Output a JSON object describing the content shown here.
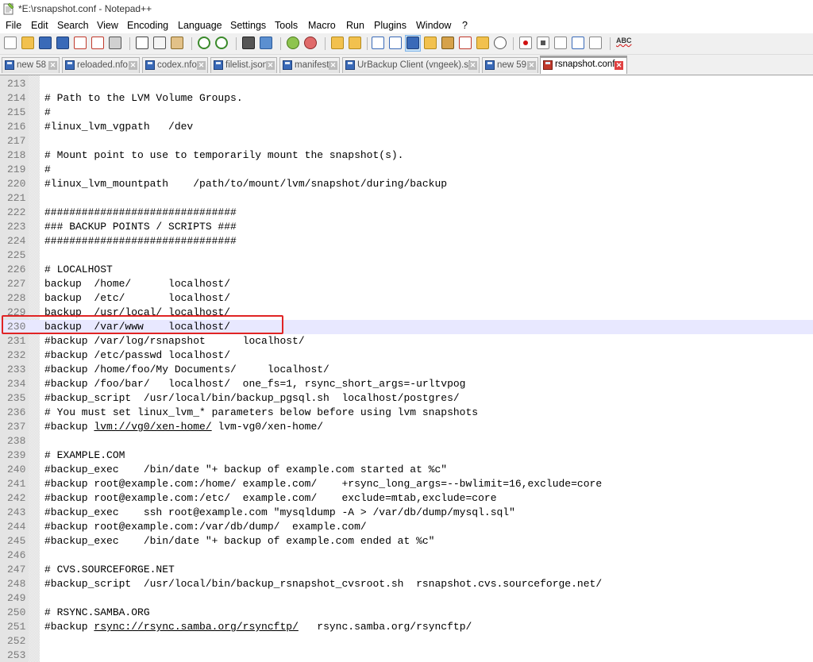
{
  "window": {
    "title": "*E:\\rsnapshot.conf - Notepad++"
  },
  "menu": [
    "File",
    "Edit",
    "Search",
    "View",
    "Encoding",
    "Language",
    "Settings",
    "Tools",
    "Macro",
    "Run",
    "Plugins",
    "Window",
    "?"
  ],
  "toolbar": {
    "icons": [
      "new-file-icon",
      "open-file-icon",
      "save-icon",
      "save-all-icon",
      "close-icon",
      "close-all-icon",
      "print-icon",
      "cut-icon",
      "copy-icon",
      "paste-icon",
      "undo-icon",
      "redo-icon",
      "find-icon",
      "replace-icon",
      "zoom-in-icon",
      "zoom-out-icon",
      "sync-vertical-icon",
      "sync-horizontal-icon",
      "word-wrap-icon",
      "show-all-chars-icon",
      "indent-guide-icon",
      "language-icon",
      "doc-map-icon",
      "function-list-icon",
      "folder-workspace-icon",
      "monitoring-icon",
      "record-macro-icon",
      "stop-record-icon",
      "play-macro-icon",
      "run-macro-multiple-icon",
      "save-macro-icon",
      "spell-check-icon"
    ],
    "spell_check_label": "ABC"
  },
  "tabs": [
    {
      "label": "new 58",
      "saved": true,
      "active": false
    },
    {
      "label": "reloaded.nfo",
      "saved": true,
      "active": false
    },
    {
      "label": "codex.nfo",
      "saved": true,
      "active": false
    },
    {
      "label": "filelist.json",
      "saved": true,
      "active": false
    },
    {
      "label": "manifest",
      "saved": true,
      "active": false
    },
    {
      "label": "UrBackup Client (vngeek).sh",
      "saved": true,
      "active": false
    },
    {
      "label": "new 59",
      "saved": true,
      "active": false
    },
    {
      "label": "rsnapshot.conf",
      "saved": false,
      "active": true
    }
  ],
  "tab_close_glyph": "✕",
  "editor": {
    "current_line": 230,
    "lines": [
      {
        "n": "213",
        "text": ""
      },
      {
        "n": "214",
        "text": "# Path to the LVM Volume Groups."
      },
      {
        "n": "215",
        "text": "#"
      },
      {
        "n": "216",
        "text": "#linux_lvm_vgpath   /dev"
      },
      {
        "n": "217",
        "text": ""
      },
      {
        "n": "218",
        "text": "# Mount point to use to temporarily mount the snapshot(s)."
      },
      {
        "n": "219",
        "text": "#"
      },
      {
        "n": "220",
        "text": "#linux_lvm_mountpath    /path/to/mount/lvm/snapshot/during/backup"
      },
      {
        "n": "221",
        "text": ""
      },
      {
        "n": "222",
        "text": "###############################"
      },
      {
        "n": "223",
        "text": "### BACKUP POINTS / SCRIPTS ###"
      },
      {
        "n": "224",
        "text": "###############################"
      },
      {
        "n": "225",
        "text": ""
      },
      {
        "n": "226",
        "text": "# LOCALHOST"
      },
      {
        "n": "227",
        "text": "backup  /home/      localhost/"
      },
      {
        "n": "228",
        "text": "backup  /etc/       localhost/"
      },
      {
        "n": "229",
        "text": "backup  /usr/local/ localhost/"
      },
      {
        "n": "230",
        "text": "backup  /var/www    localhost/"
      },
      {
        "n": "231",
        "text": "#backup /var/log/rsnapshot      localhost/"
      },
      {
        "n": "232",
        "text": "#backup /etc/passwd localhost/"
      },
      {
        "n": "233",
        "text": "#backup /home/foo/My Documents/     localhost/"
      },
      {
        "n": "234",
        "text": "#backup /foo/bar/   localhost/  one_fs=1, rsync_short_args=-urltvpog"
      },
      {
        "n": "235",
        "text": "#backup_script  /usr/local/bin/backup_pgsql.sh  localhost/postgres/"
      },
      {
        "n": "236",
        "text": "# You must set linux_lvm_* parameters below before using lvm snapshots"
      },
      {
        "n": "237",
        "text": "#backup ",
        "url": "lvm://vg0/xen-home/",
        "after": " lvm-vg0/xen-home/"
      },
      {
        "n": "238",
        "text": ""
      },
      {
        "n": "239",
        "text": "# EXAMPLE.COM"
      },
      {
        "n": "240",
        "text": "#backup_exec    /bin/date \"+ backup of example.com started at %c\""
      },
      {
        "n": "241",
        "text": "#backup root@example.com:/home/ example.com/    +rsync_long_args=--bwlimit=16,exclude=core"
      },
      {
        "n": "242",
        "text": "#backup root@example.com:/etc/  example.com/    exclude=mtab,exclude=core"
      },
      {
        "n": "243",
        "text": "#backup_exec    ssh root@example.com \"mysqldump -A > /var/db/dump/mysql.sql\""
      },
      {
        "n": "244",
        "text": "#backup root@example.com:/var/db/dump/  example.com/"
      },
      {
        "n": "245",
        "text": "#backup_exec    /bin/date \"+ backup of example.com ended at %c\""
      },
      {
        "n": "246",
        "text": ""
      },
      {
        "n": "247",
        "text": "# CVS.SOURCEFORGE.NET"
      },
      {
        "n": "248",
        "text": "#backup_script  /usr/local/bin/backup_rsnapshot_cvsroot.sh  rsnapshot.cvs.sourceforge.net/"
      },
      {
        "n": "249",
        "text": ""
      },
      {
        "n": "250",
        "text": "# RSYNC.SAMBA.ORG"
      },
      {
        "n": "251",
        "text": "#backup ",
        "url": "rsync://rsync.samba.org/rsyncftp/",
        "after": "   rsync.samba.org/rsyncftp/"
      },
      {
        "n": "252",
        "text": ""
      },
      {
        "n": "253",
        "text": ""
      }
    ]
  },
  "colors": {
    "current_line_bg": "#e8e8ff",
    "annotation_box": "#e02424",
    "active_tab_accent": "#f5a142"
  }
}
